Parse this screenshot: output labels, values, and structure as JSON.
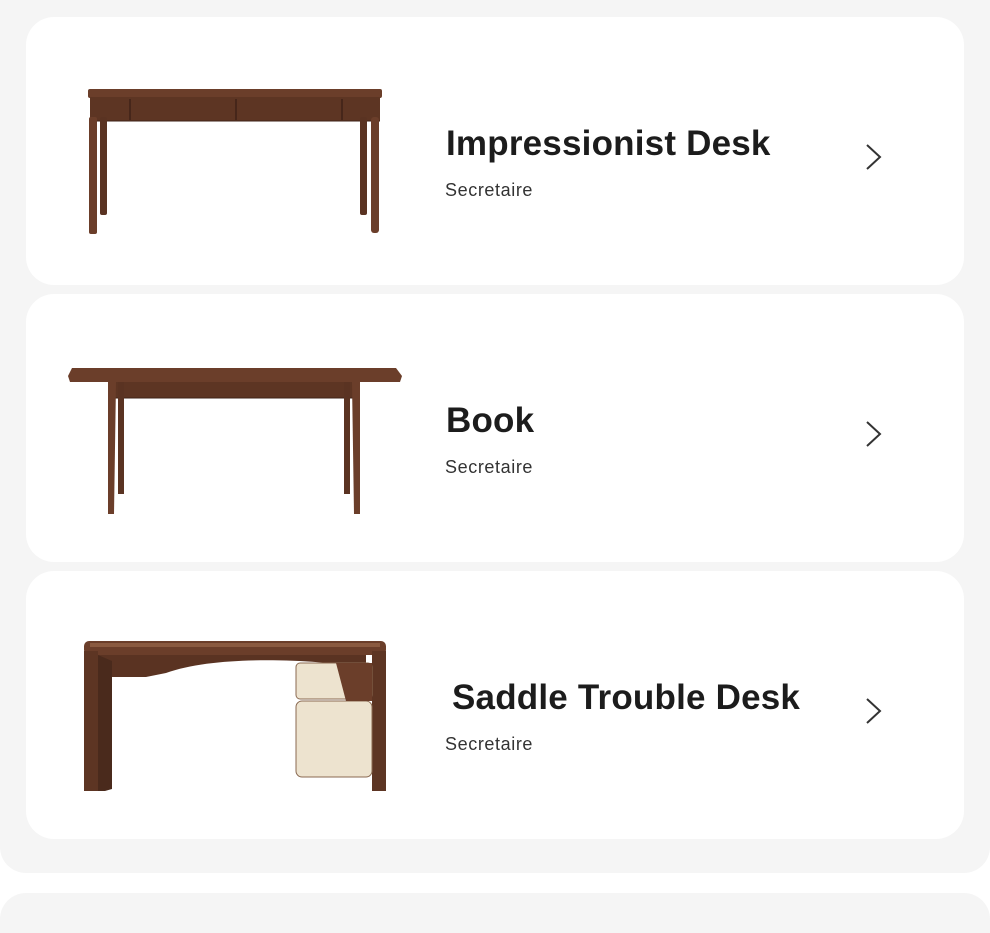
{
  "products": [
    {
      "name": "Impressionist Desk",
      "category": "Secretaire",
      "image": "desk-with-drawers-image",
      "action_icon": "chevron-right-icon"
    },
    {
      "name": "Book",
      "category": "Secretaire",
      "image": "writing-table-image",
      "action_icon": "chevron-right-icon"
    },
    {
      "name": "Saddle Trouble Desk",
      "category": "Secretaire",
      "image": "desk-with-cabinet-image",
      "action_icon": "chevron-right-icon"
    }
  ],
  "colors": {
    "background": "#f5f5f5",
    "card": "#ffffff",
    "wood": "#6b3e2a",
    "wood_dark": "#4a2a1c",
    "cream": "#ede3cf",
    "title_text": "#1c1c1c",
    "chevron": "#333333"
  }
}
